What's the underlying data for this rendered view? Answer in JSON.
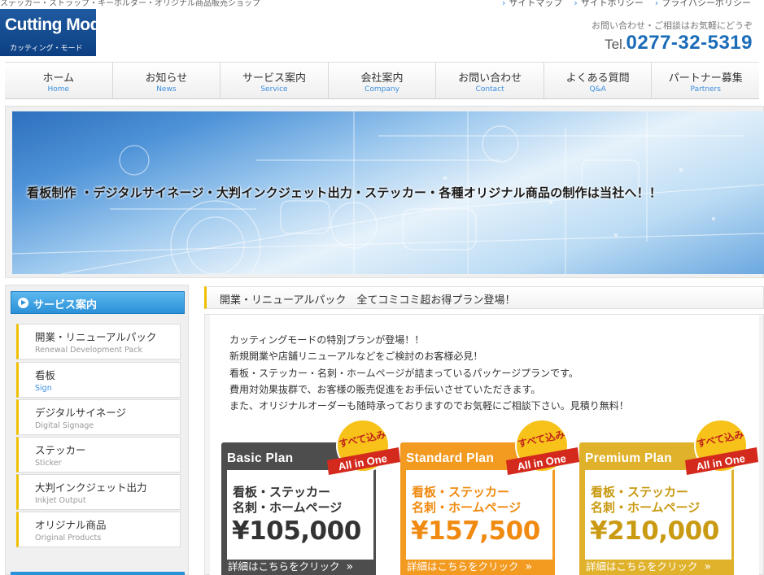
{
  "header": {
    "tagline": "ステッカー・ストラップ・キーホルダー・オリジナル商品販売ショップ",
    "logo_main": "Cutting Mode",
    "logo_sub": "カッティング・モード",
    "util_links": [
      "サイトマップ",
      "サイトポリシー",
      "プライバシーポリシー"
    ],
    "contact_note": "お問い合わせ・ご相談はお気軽にどうぞ",
    "phone_prefix": "Tel.",
    "phone": "0277-32-5319"
  },
  "nav": [
    {
      "jp": "ホーム",
      "en": "Home"
    },
    {
      "jp": "お知らせ",
      "en": "News"
    },
    {
      "jp": "サービス案内",
      "en": "Service"
    },
    {
      "jp": "会社案内",
      "en": "Company"
    },
    {
      "jp": "お問い合わせ",
      "en": "Contact"
    },
    {
      "jp": "よくある質問",
      "en": "Q&A"
    },
    {
      "jp": "パートナー募集",
      "en": "Partners"
    }
  ],
  "banner": {
    "text": "看板制作 ・デジタルサイネージ・大判インクジェット出力・ステッカー・各種オリジナル商品の制作は当社へ！！"
  },
  "sidebar": {
    "title": "サービス案内",
    "items": [
      {
        "jp": "開業・リニューアルパック",
        "en": "Renewal Development Pack"
      },
      {
        "jp": "看板",
        "en": "Sign"
      },
      {
        "jp": "デジタルサイネージ",
        "en": "Digital Signage"
      },
      {
        "jp": "ステッカー",
        "en": "Sticker"
      },
      {
        "jp": "大判インクジェット出力",
        "en": "Inkjet Output"
      },
      {
        "jp": "オリジナル商品",
        "en": "Original Products"
      }
    ]
  },
  "main": {
    "title": "開業・リニューアルパック　全てコミコミ超お得プラン登場！",
    "intro": [
      "カッティングモードの特別プランが登場！！",
      "新規開業や店舗リニューアルなどをご検討のお客様必見！",
      "看板・ステッカー・名刺・ホームページが詰まっているパッケージプランです。",
      "費用対効果抜群で、お客様の販売促進をお手伝いさせていただきます。",
      "また、オリジナルオーダーも随時承っておりますのでお気軽にご相談下さい。見積り無料！"
    ],
    "badge_top": "すべて込み",
    "badge_bottom": "All in One",
    "plans": [
      {
        "name": "Basic Plan",
        "line1": "看板・ステッカー",
        "line2": "名刺・ホームページ",
        "price": "¥105,000",
        "more": "詳細はこちらをクリック"
      },
      {
        "name": "Standard Plan",
        "line1": "看板・ステッカー",
        "line2": "名刺・ホームページ",
        "price": "¥157,500",
        "more": "詳細はこちらをクリック"
      },
      {
        "name": "Premium Plan",
        "line1": "看板・ステッカー",
        "line2": "名刺・ホームページ",
        "price": "¥210,000",
        "more": "詳細はこちらをクリック"
      }
    ]
  },
  "colors": {
    "brand_blue": "#1a6cb8",
    "accent_yellow": "#f0c000",
    "basic": "#4d4d4d",
    "standard": "#f39a20",
    "premium": "#e0b22c",
    "badge_red": "#d42a1e"
  }
}
